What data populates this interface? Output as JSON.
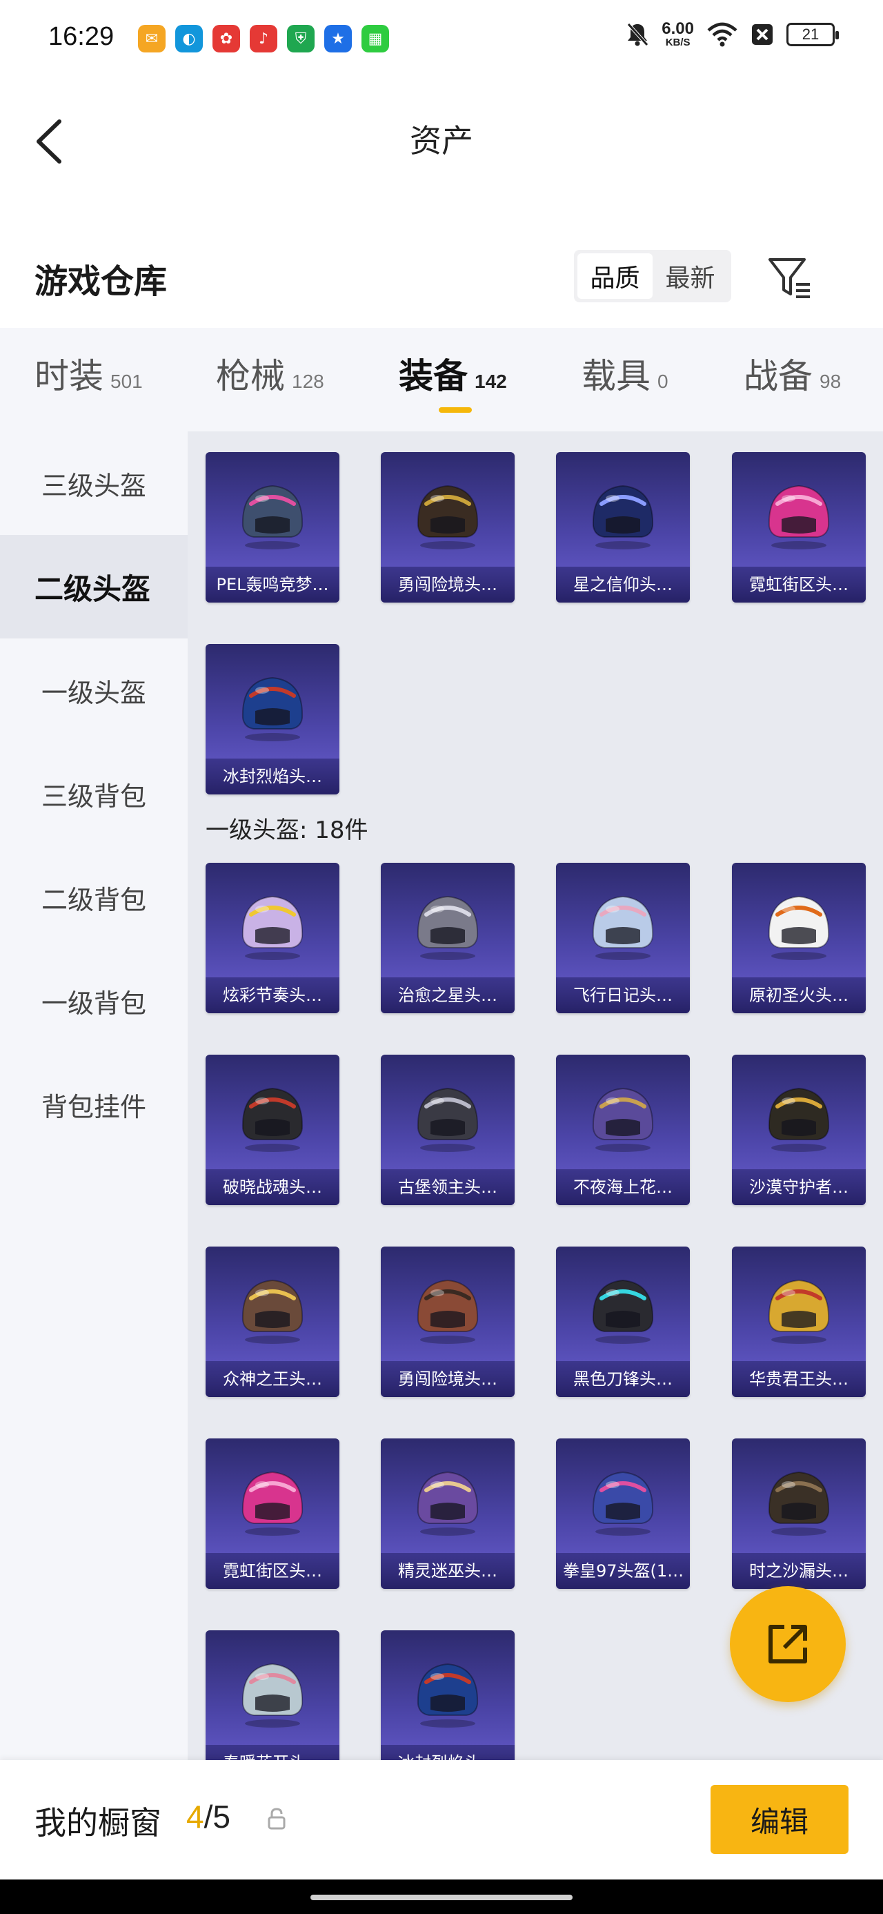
{
  "status_bar": {
    "time": "16:29",
    "net_speed_value": "6.00",
    "net_speed_unit": "KB/S",
    "battery": "21",
    "app_icons": [
      {
        "name": "mail-app-icon",
        "color": "#f5a623"
      },
      {
        "name": "qq-app-icon",
        "color": "#1296db"
      },
      {
        "name": "news-app-icon",
        "color": "#e53935"
      },
      {
        "name": "music-app-icon",
        "color": "#e53935"
      },
      {
        "name": "shield-app-icon",
        "color": "#1fa750"
      },
      {
        "name": "star-app-icon",
        "color": "#1e6fe6"
      },
      {
        "name": "android-app-icon",
        "color": "#2ecc40"
      }
    ]
  },
  "header": {
    "title": "资产"
  },
  "warehouse": {
    "title": "游戏仓库",
    "sort_options": [
      "品质",
      "最新"
    ],
    "sort_active": 0
  },
  "category_tabs": [
    {
      "label": "时装",
      "count": "501"
    },
    {
      "label": "枪械",
      "count": "128"
    },
    {
      "label": "装备",
      "count": "142"
    },
    {
      "label": "载具",
      "count": "0"
    },
    {
      "label": "战备",
      "count": "98"
    }
  ],
  "active_tab": 2,
  "sidebar": [
    {
      "label": "三级头盔"
    },
    {
      "label": "二级头盔"
    },
    {
      "label": "一级头盔"
    },
    {
      "label": "三级背包"
    },
    {
      "label": "二级背包"
    },
    {
      "label": "一级背包"
    },
    {
      "label": "背包挂件"
    }
  ],
  "active_sidebar": 1,
  "level2_helmets": [
    {
      "name": "PEL轰鸣竞梦…",
      "color": "#3e4f6e",
      "accent": "#e04fa0"
    },
    {
      "name": "勇闯险境头…",
      "color": "#3a2c22",
      "accent": "#c9a23a"
    },
    {
      "name": "星之信仰头…",
      "color": "#1e2a66",
      "accent": "#8a9cff"
    },
    {
      "name": "霓虹街区头…",
      "color": "#d8348e",
      "accent": "#f7a6d3"
    },
    {
      "name": "冰封烈焰头…",
      "color": "#1d3f8e",
      "accent": "#c23a2a"
    }
  ],
  "level1_section_label": "一级头盔: 18件",
  "level1_helmets": [
    {
      "name": "炫彩节奏头…",
      "color": "#c9b2e6",
      "accent": "#f0c830"
    },
    {
      "name": "治愈之星头…",
      "color": "#7a7a8a",
      "accent": "#d8d8e4"
    },
    {
      "name": "飞行日记头…",
      "color": "#b9cbe8",
      "accent": "#e8a8c0"
    },
    {
      "name": "原初圣火头…",
      "color": "#f2f2f2",
      "accent": "#e06a1a"
    },
    {
      "name": "破晓战魂头…",
      "color": "#2a2a2e",
      "accent": "#c23a2a"
    },
    {
      "name": "古堡领主头…",
      "color": "#3a3a44",
      "accent": "#b8b8c8"
    },
    {
      "name": "不夜海上花…",
      "color": "#5a4a9a",
      "accent": "#c9a050"
    },
    {
      "name": "沙漠守护者…",
      "color": "#2e2a22",
      "accent": "#d8a83a"
    },
    {
      "name": "众神之王头…",
      "color": "#6a4a3a",
      "accent": "#e8c050"
    },
    {
      "name": "勇闯险境头…",
      "color": "#8a4a36",
      "accent": "#3a2a22"
    },
    {
      "name": "黑色刀锋头…",
      "color": "#2a2a30",
      "accent": "#36d6e0"
    },
    {
      "name": "华贵君王头…",
      "color": "#d8a830",
      "accent": "#c23a2a"
    },
    {
      "name": "霓虹街区头…",
      "color": "#d8348e",
      "accent": "#f7a6d3"
    },
    {
      "name": "精灵迷巫头…",
      "color": "#6a4aa0",
      "accent": "#e8c890"
    },
    {
      "name": "拳皇97头盔(1…",
      "color": "#3a4aa8",
      "accent": "#e04fa0"
    },
    {
      "name": "时之沙漏头…",
      "color": "#3a3026",
      "accent": "#8a7050"
    },
    {
      "name": "春暖花开头…",
      "color": "#b8c8d0",
      "accent": "#e08aa0"
    },
    {
      "name": "冰封烈焰头…",
      "color": "#1d3f8e",
      "accent": "#c23a2a"
    }
  ],
  "bottom_bar": {
    "label": "我的橱窗",
    "current": "4",
    "separator": "/",
    "total": "5",
    "edit_label": "编辑"
  },
  "colors": {
    "accent": "#f8b512",
    "card_bg": "#4c45a8"
  }
}
